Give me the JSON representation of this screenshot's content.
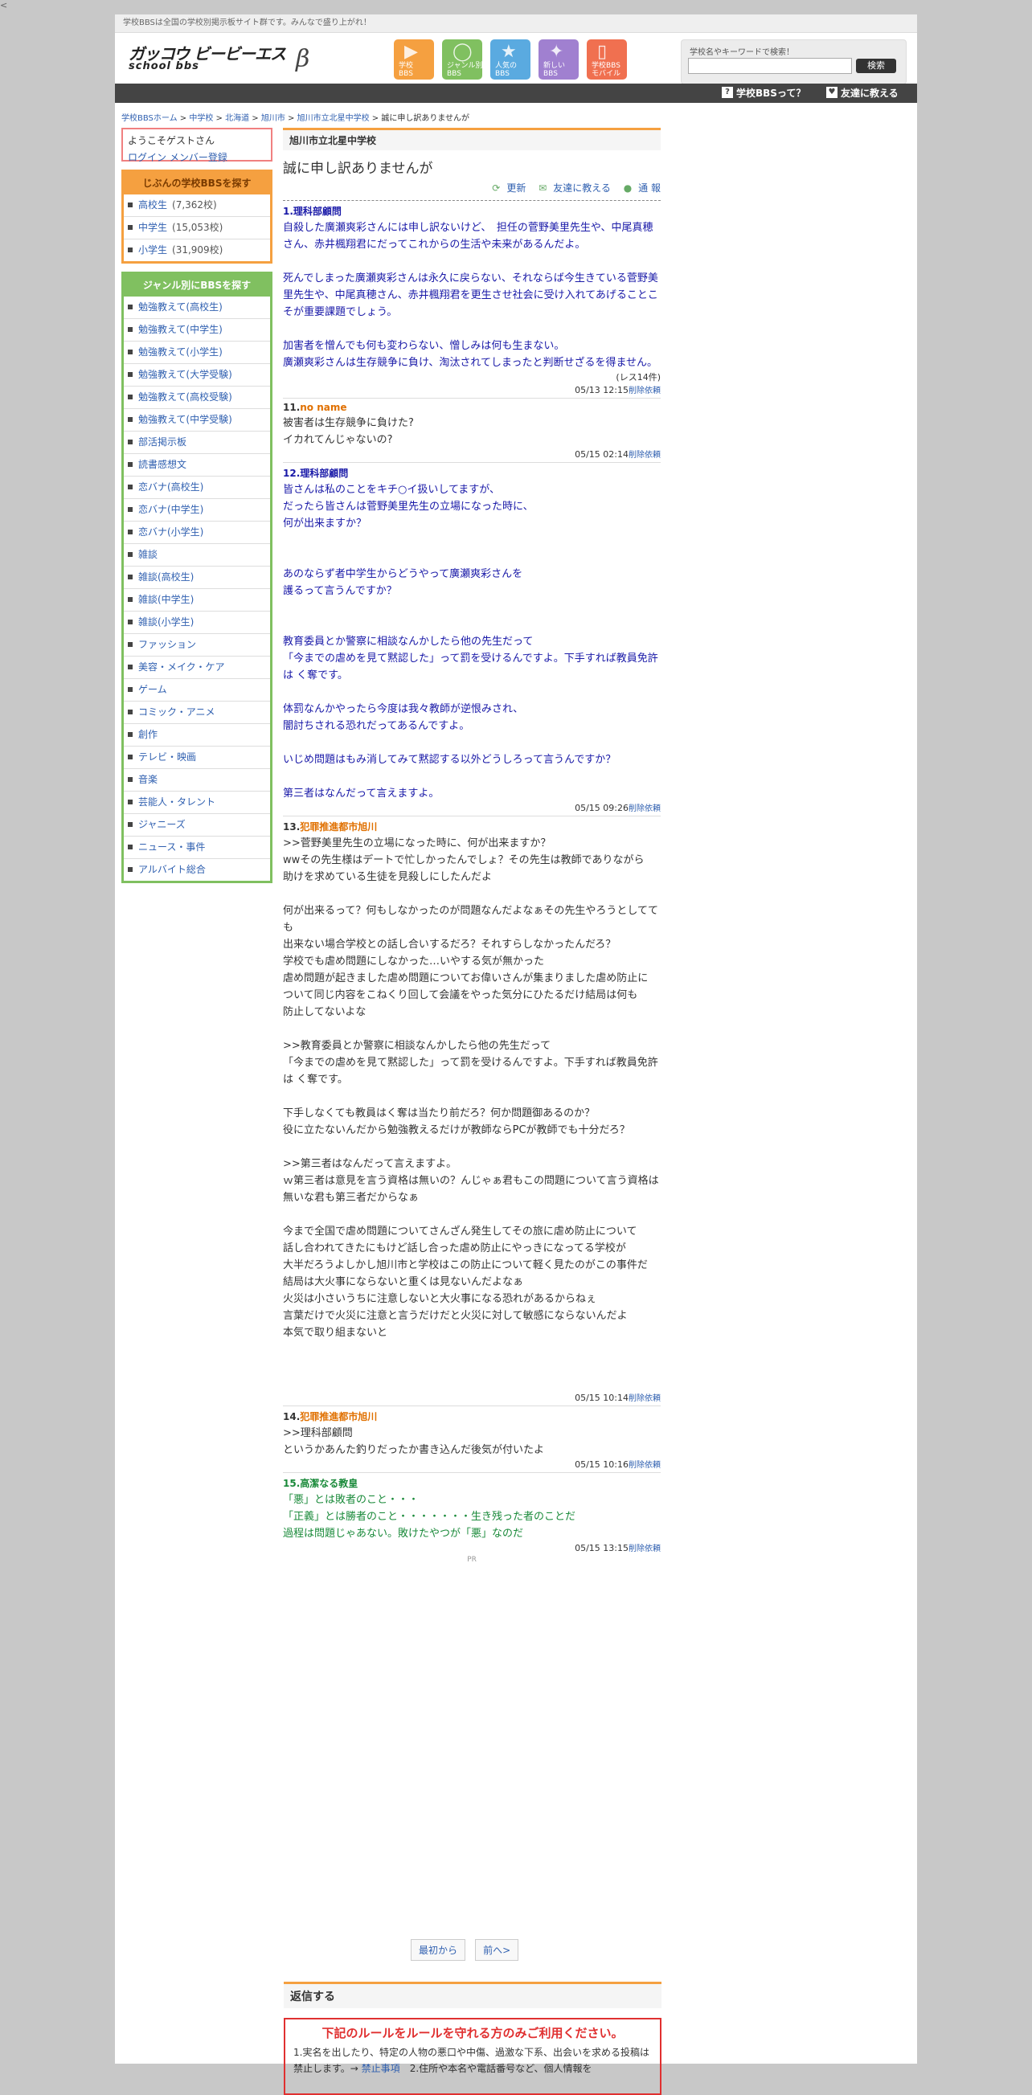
{
  "corner": "<",
  "topbar": "学校BBSは全国の学校別掲示板サイト群です。みんなで盛り上がれ！",
  "logo": {
    "line1": "ガッコウ ビービーエス",
    "line2": "school bbs",
    "beta": "β"
  },
  "nav": [
    {
      "label": "学校\nBBS",
      "color": "#f5a040",
      "symbol": "▶"
    },
    {
      "label": "ジャンル別\nBBS",
      "color": "#80c060",
      "symbol": "◯"
    },
    {
      "label": "人気の\nBBS",
      "color": "#5aaae0",
      "symbol": "★"
    },
    {
      "label": "新しい\nBBS",
      "color": "#a080d0",
      "symbol": "✦"
    },
    {
      "label": "学校BBS\nモバイル",
      "color": "#f07050",
      "symbol": "▯"
    }
  ],
  "search": {
    "label": "学校名やキーワードで検索！",
    "placeholder": "",
    "button": "検索"
  },
  "darkbar": {
    "about": "学校BBSって？",
    "tell": "友達に教える"
  },
  "breadcrumb": [
    "学校BBSホーム",
    "中学校",
    "北海道",
    "旭川市",
    "旭川市立北星中学校",
    "誠に申し訳ありませんが"
  ],
  "welcome": {
    "text": "ようこそゲストさん",
    "login": "ログイン",
    "register": "メンバー登録"
  },
  "school_box": {
    "title": "じぶんの学校BBSを探す",
    "items": [
      {
        "label": "高校生",
        "count": "(7,362校)"
      },
      {
        "label": "中学生",
        "count": "(15,053校)"
      },
      {
        "label": "小学生",
        "count": "(31,909校)"
      }
    ]
  },
  "genre_box": {
    "title": "ジャンル別にBBSを探す",
    "items": [
      "勉強教えて(高校生)",
      "勉強教えて(中学生)",
      "勉強教えて(小学生)",
      "勉強教えて(大学受験)",
      "勉強教えて(高校受験)",
      "勉強教えて(中学受験)",
      "部活掲示板",
      "読書感想文",
      "恋バナ(高校生)",
      "恋バナ(中学生)",
      "恋バナ(小学生)",
      "雑談",
      "雑談(高校生)",
      "雑談(中学生)",
      "雑談(小学生)",
      "ファッション",
      "美容・メイク・ケア",
      "ゲーム",
      "コミック・アニメ",
      "創作",
      "テレビ・映画",
      "音楽",
      "芸能人・タレント",
      "ジャニーズ",
      "ニュース・事件",
      "アルバイト総合"
    ]
  },
  "board": {
    "name": "旭川市立北星中学校",
    "title": "誠に申し訳ありませんが"
  },
  "tools": {
    "update": "更新",
    "tell": "友達に教える",
    "report": "通 報"
  },
  "posts": [
    {
      "no": "1.",
      "name": "理科部顧問",
      "style": "blue",
      "body": "自殺した廣瀬爽彩さんには申し訳ないけど、　担任の菅野美里先生や、中尾真穂さん、赤井楓翔君にだってこれからの生活や未来があるんだよ。\n\n死んでしまった廣瀬爽彩さんは永久に戻らない、それならば今生きている菅野美里先生や、中尾真穂さん、赤井楓翔君を更生させ社会に受け入れてあげることこそが重要課題でしょう。\n\n加害者を憎んでも何も変わらない、憎しみは何も生まない。\n廣瀬爽彩さんは生存競争に負け、淘汰されてしまったと判断せざるを得ません。",
      "extra": "(レス14件)",
      "date": "05/13 12:15",
      "del": "削除依頼"
    },
    {
      "no": "11.",
      "name": "no name",
      "style": "normal",
      "nameClass": "orangename",
      "body": "被害者は生存競争に負けた?\nイカれてんじゃないの?",
      "extra": "",
      "date": "05/15 02:14",
      "del": "削除依頼"
    },
    {
      "no": "12.",
      "name": "理科部顧問",
      "style": "blue",
      "body": "皆さんは私のことをキチ○イ扱いしてますが、\nだったら皆さんは菅野美里先生の立場になった時に、\n何が出来ますか？\n\n\nあのならず者中学生からどうやって廣瀬爽彩さんを\n護るって言うんですか？\n\n\n教育委員とか警察に相談なんかしたら他の先生だって\n「今までの虐めを見て黙認した」って罰を受けるんですよ。下手すれば教員免許は く奪です。\n\n体罰なんかやったら今度は我々教師が逆恨みされ、\n闇討ちされる恐れだってあるんですよ。\n\nいじめ問題はもみ消してみて黙認する以外どうしろって言うんですか？\n\n第三者はなんだって言えますよ。",
      "extra": "",
      "date": "05/15 09:26",
      "del": "削除依頼"
    },
    {
      "no": "13.",
      "name": "犯罪推進都市旭川",
      "style": "normal",
      "nameClass": "orangename",
      "body": ">>菅野美里先生の立場になった時に、何が出来ますか？\nwwその先生様はデートで忙しかったんでしょ？その先生は教師でありながら\n助けを求めている生徒を見殺しにしたんだよ\n\n何が出来るって？何もしなかったのが問題なんだよなぁその先生やろうとしてても\n出来ない場合学校との話し合いするだろ？それすらしなかったんだろ？\n学校でも虐め問題にしなかった…いやする気が無かった\n虐め問題が起きました虐め問題についてお偉いさんが集まりました虐め防止に\nついて同じ内容をこねくり回して会議をやった気分にひたるだけ結局は何も\n防止してないよな\n\n>>教育委員とか警察に相談なんかしたら他の先生だって\n「今までの虐めを見て黙認した」って罰を受けるんですよ。下手すれば教員免許は く奪です。\n\n下手しなくても教員はく奪は当たり前だろ？何か問題御あるのか？\n役に立たないんだから勉強教えるだけが教師ならPCが教師でも十分だろ？\n\n>>第三者はなんだって言えますよ。\nｗ第三者は意見を言う資格は無いの？んじゃぁ君もこの問題について言う資格は無いな君も第三者だからなぁ\n\n今まで全国で虐め問題についてさんざん発生してその旅に虐め防止について\n話し合われてきたにもけど話し合った虐め防止にやっきになってる学校が\n大半だろうよしかし旭川市と学校はこの防止について軽く見たのがこの事件だ\n結局は大火事にならないと重くは見ないんだよなぁ\n火災は小さいうちに注意しないと大火事になる恐れがあるからねぇ\n言葉だけで火災に注意と言うだけだと火災に対して敏感にならないんだよ\n本気で取り組まないと\n\n\n\n",
      "extra": "",
      "date": "05/15 10:14",
      "del": "削除依頼"
    },
    {
      "no": "14.",
      "name": "犯罪推進都市旭川",
      "style": "normal",
      "nameClass": "orangename",
      "body": ">>理科部顧問\nというかあんた釣りだったか書き込んだ後気が付いたよ",
      "extra": "",
      "date": "05/15 10:16",
      "del": "削除依頼"
    },
    {
      "no": "15.",
      "name": "高潔なる教皇",
      "style": "green",
      "body": "「悪」とは敗者のこと・・・\n「正義」とは勝者のこと・・・・・・・生き残った者のことだ\n過程は問題じゃあない。敗けたやつが「悪」なのだ",
      "extra": "",
      "date": "05/15 13:15",
      "del": "削除依頼"
    }
  ],
  "pr": "PR",
  "pager": {
    "first": "最初から",
    "prev": "前へ>"
  },
  "reply": {
    "title": "返信する",
    "rules_title": "下記のルールをルールを守れる方のみご利用ください。",
    "rules_text": "1.実名を出したり、特定の人物の悪口や中傷、過激な下系、出会いを求める投稿は禁止します。→ ",
    "rules_link": "禁止事項",
    "rules_text2": "　2.住所や本名や電話番号など、個人情報を"
  }
}
